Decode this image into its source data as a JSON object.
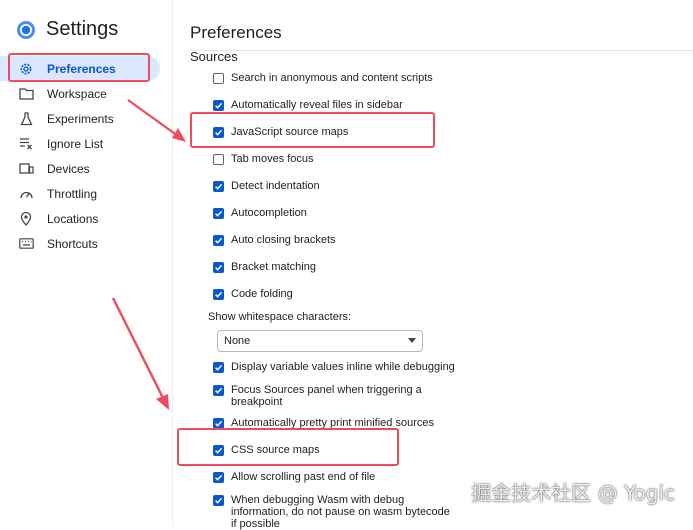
{
  "header": {
    "title": "Settings",
    "logo_icon": "devtools-logo-icon"
  },
  "sidebar": {
    "items": [
      {
        "label": "Preferences",
        "icon": "gear-icon",
        "active": true
      },
      {
        "label": "Workspace",
        "icon": "folder-icon"
      },
      {
        "label": "Experiments",
        "icon": "flask-icon"
      },
      {
        "label": "Ignore List",
        "icon": "ignore-list-icon"
      },
      {
        "label": "Devices",
        "icon": "devices-icon"
      },
      {
        "label": "Throttling",
        "icon": "speedometer-icon"
      },
      {
        "label": "Locations",
        "icon": "location-pin-icon"
      },
      {
        "label": "Shortcuts",
        "icon": "keyboard-icon"
      }
    ]
  },
  "main": {
    "title": "Preferences",
    "section_title": "Sources",
    "options_a": [
      {
        "label": "Search in anonymous and content scripts",
        "checked": false
      },
      {
        "label": "Automatically reveal files in sidebar",
        "checked": true
      },
      {
        "label": "JavaScript source maps",
        "checked": true
      },
      {
        "label": "Tab moves focus",
        "checked": false
      },
      {
        "label": "Detect indentation",
        "checked": true
      },
      {
        "label": "Autocompletion",
        "checked": true
      },
      {
        "label": "Auto closing brackets",
        "checked": true
      },
      {
        "label": "Bracket matching",
        "checked": true
      },
      {
        "label": "Code folding",
        "checked": true
      }
    ],
    "whitespace": {
      "label": "Show whitespace characters:",
      "value": "None"
    },
    "options_b": [
      {
        "label": "Display variable values inline while debugging",
        "checked": true
      },
      {
        "label": "Focus Sources panel when triggering a breakpoint",
        "checked": true
      },
      {
        "label": "Automatically pretty print minified sources",
        "checked": true
      },
      {
        "label": "CSS source maps",
        "checked": true
      },
      {
        "label": "Allow scrolling past end of file",
        "checked": true
      },
      {
        "label": "When debugging Wasm with debug information, do not pause on wasm bytecode if possible",
        "checked": true
      }
    ]
  },
  "annotation": {
    "highlight_color": "#ef4b5e"
  },
  "watermark": "掘金技术社区 @ Yogic"
}
